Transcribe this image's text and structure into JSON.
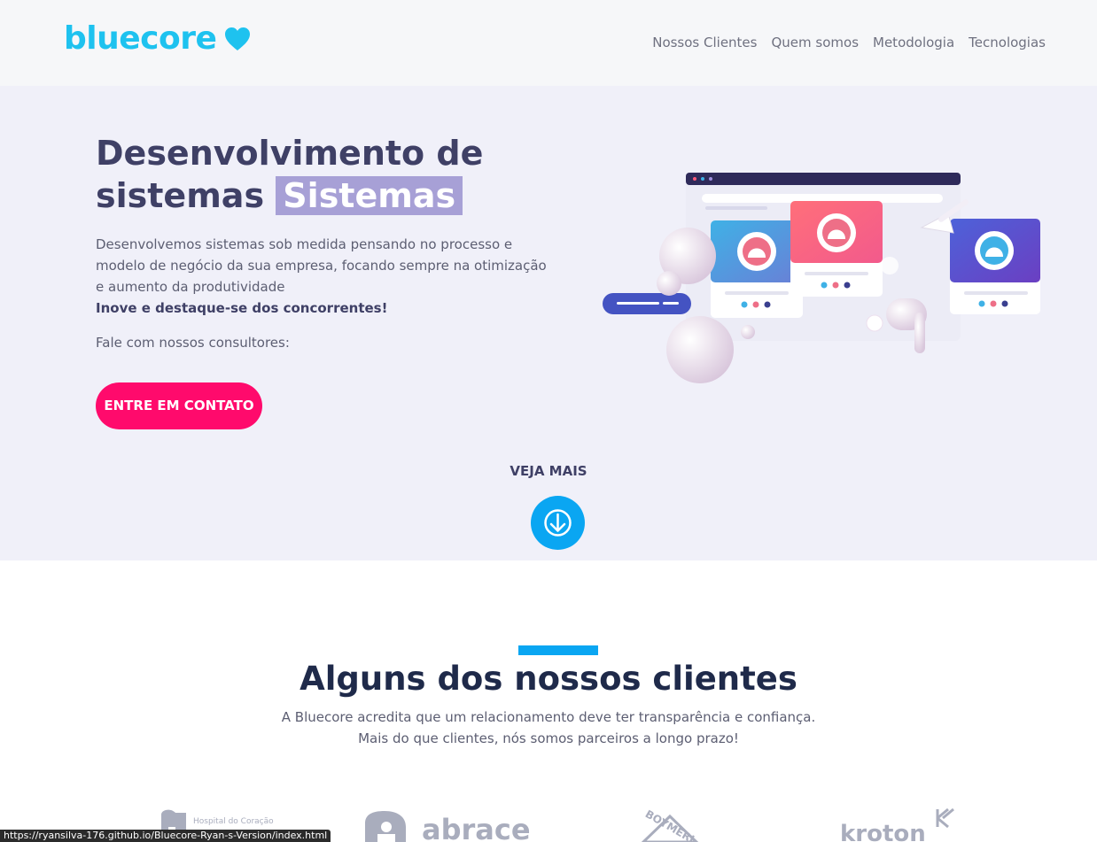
{
  "header": {
    "logo_text": "bluecore",
    "nav": [
      "Nossos Clientes",
      "Quem somos",
      "Metodologia",
      "Tecnologias"
    ]
  },
  "hero": {
    "title_line1": "Desenvolvimento de",
    "title_line2_prefix": "sistemas",
    "title_highlight": "Sistemas",
    "description": "Desenvolvemos sistemas sob medida pensando no processo e modelo de negócio da sua empresa, focando sempre na otimização e aumento da produtividade",
    "emphasis": "Inove e destaque-se dos concorrentes!",
    "cta_label": "Fale com nossos consultores:",
    "cta_button": "ENTRE EM CONTATO",
    "see_more": "VEJA MAIS"
  },
  "clients": {
    "title": "Alguns dos nossos clientes",
    "subtitle_line1": "A Bluecore acredita que um relacionamento deve ter transparência e confiança.",
    "subtitle_line2": "Mais do que clientes, nós somos parceiros a longo prazo!",
    "logos": [
      {
        "name": "Hospital do Coração",
        "icon": "hospital-logo"
      },
      {
        "name": "abrace",
        "icon": "abrace-logo"
      },
      {
        "name": "BOYMERI",
        "icon": "boymeri-logo"
      },
      {
        "name": "kroton",
        "icon": "kroton-logo"
      }
    ]
  },
  "status_bar": {
    "url": "https://ryansilva-176.github.io/Bluecore-Ryan-s-Version/index.html"
  },
  "colors": {
    "brand": "#1ec2ef",
    "cta": "#ff0a6c",
    "accent_blue": "#0aa6f2",
    "highlight": "#a7a0d6",
    "hero_bg": "#f0f0f9"
  }
}
